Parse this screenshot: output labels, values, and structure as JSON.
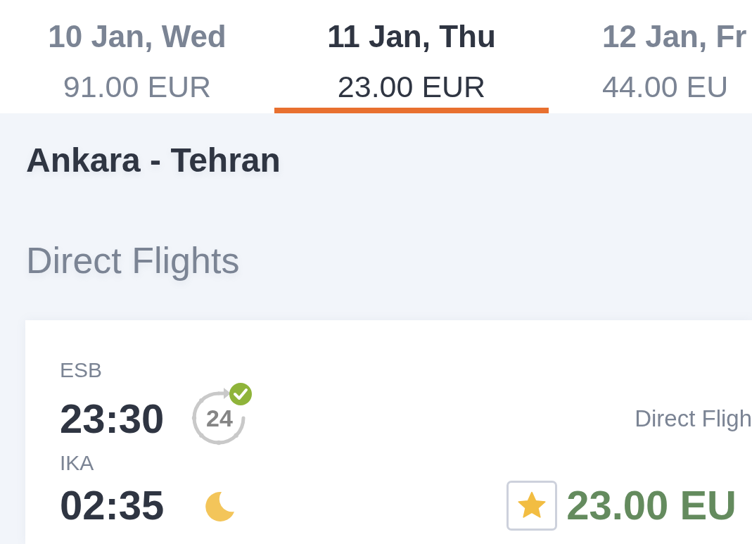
{
  "date_tabs": [
    {
      "date": "10 Jan, Wed",
      "price": "91.00 EUR",
      "selected": false
    },
    {
      "date": "11 Jan, Thu",
      "price": "23.00 EUR",
      "selected": true
    },
    {
      "date": "12 Jan, Fr",
      "price": "44.00 EU",
      "selected": false
    }
  ],
  "route": {
    "title": "Ankara - Tehran"
  },
  "section": {
    "title": "Direct Flights"
  },
  "flights": [
    {
      "departure": {
        "airport": "ESB",
        "time": "23:30",
        "hours": "24"
      },
      "arrival": {
        "airport": "IKA",
        "time": "02:35"
      },
      "flight_type": "Direct Fligh",
      "favorite": true,
      "price": "23.00 EU"
    }
  ]
}
